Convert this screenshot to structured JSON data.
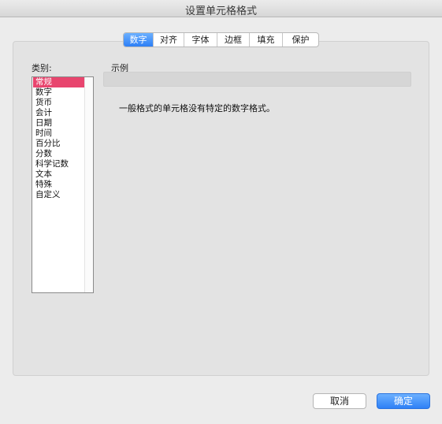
{
  "window": {
    "title": "设置单元格格式"
  },
  "tabs": [
    {
      "label": "数字",
      "active": true
    },
    {
      "label": "对齐",
      "active": false
    },
    {
      "label": "字体",
      "active": false
    },
    {
      "label": "边框",
      "active": false
    },
    {
      "label": "填充",
      "active": false
    },
    {
      "label": "保护",
      "active": false
    }
  ],
  "category": {
    "label": "类别:",
    "selected": "常规",
    "items": [
      "常规",
      "数字",
      "货币",
      "会计",
      "日期",
      "时间",
      "百分比",
      "分数",
      "科学记数",
      "文本",
      "特殊",
      "自定义"
    ]
  },
  "sample": {
    "label": "示例",
    "value": ""
  },
  "description": "一般格式的单元格没有特定的数字格式。",
  "buttons": {
    "cancel": "取消",
    "ok": "确定"
  },
  "colors": {
    "accent": "#2d7ff6",
    "selection": "#e8456e"
  }
}
